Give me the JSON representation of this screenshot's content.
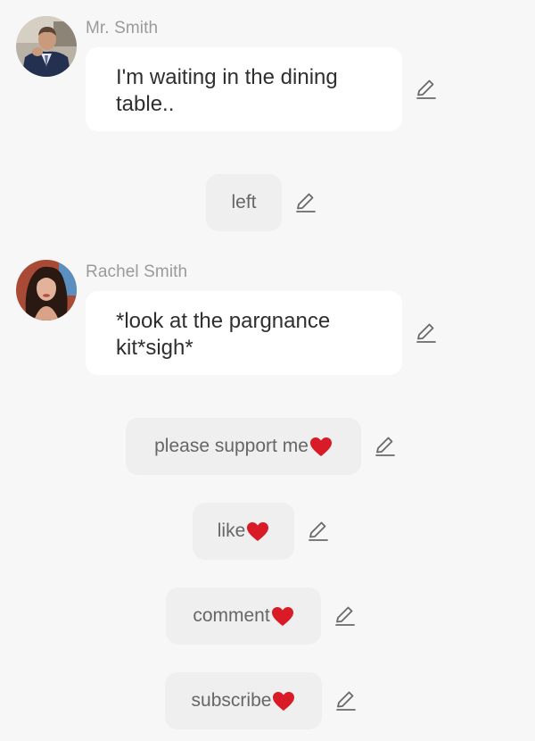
{
  "messages": [
    {
      "sender": "Mr. Smith",
      "avatar": "man-in-suit-avatar",
      "text": "I'm waiting in the dining table.."
    },
    {
      "sender": "Rachel Smith",
      "avatar": "woman-dark-hair-avatar",
      "text": "*look at the pargnance kit*sigh*"
    }
  ],
  "choices": [
    {
      "label": "left",
      "heart": false
    },
    {
      "label": "please support me",
      "heart": true
    },
    {
      "label": "like",
      "heart": true
    },
    {
      "label": "comment",
      "heart": true
    },
    {
      "label": "subscribe",
      "heart": true
    }
  ],
  "icons": {
    "edit": "pencil-edit-icon",
    "heart": "red-heart-icon"
  },
  "colors": {
    "background": "#f7f7f7",
    "bubble": "#ffffff",
    "choice_pill": "#efefef",
    "sender_name": "#9a9a9a",
    "message_text": "#2f2f2f",
    "choice_text": "#666666",
    "heart": "#d81b27"
  }
}
